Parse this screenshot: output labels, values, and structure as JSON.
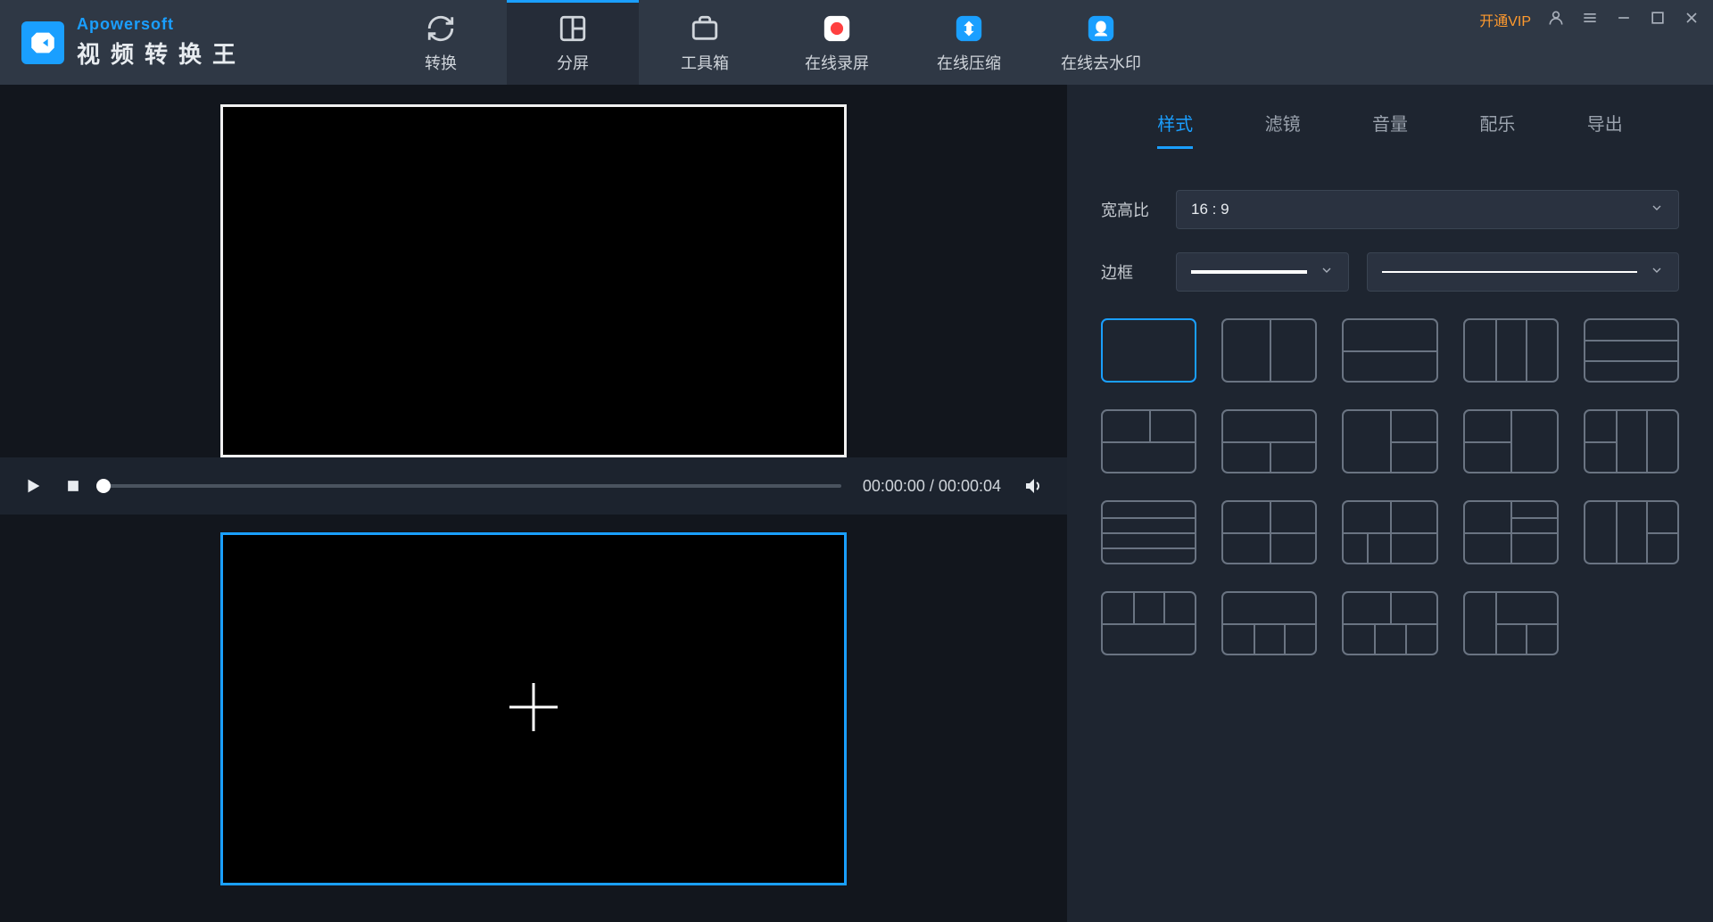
{
  "brand": {
    "top": "Apowersoft",
    "bottom": "视频转换王"
  },
  "nav": {
    "items": [
      {
        "label": "转换"
      },
      {
        "label": "分屏"
      },
      {
        "label": "工具箱"
      },
      {
        "label": "在线录屏"
      },
      {
        "label": "在线压缩"
      },
      {
        "label": "在线去水印"
      }
    ],
    "active_index": 1
  },
  "window": {
    "vip": "开通VIP"
  },
  "player": {
    "current_time": "00:00:00",
    "total_time": "00:00:04",
    "separator": " / "
  },
  "tabs": {
    "items": [
      "样式",
      "滤镜",
      "音量",
      "配乐",
      "导出"
    ],
    "active_index": 0
  },
  "controls": {
    "aspect_label": "宽高比",
    "aspect_value": "16 : 9",
    "border_label": "边框"
  },
  "layouts": {
    "selected_index": 0
  }
}
